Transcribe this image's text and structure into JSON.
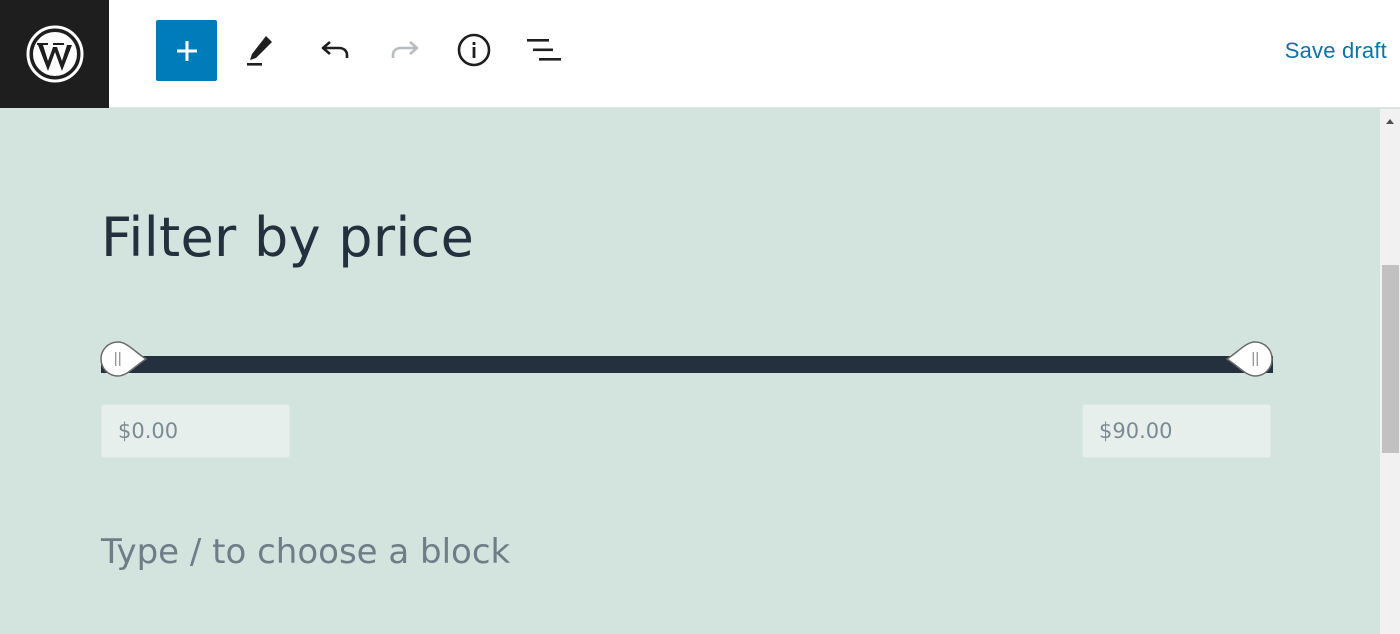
{
  "toolbar": {
    "logo_icon": "wordpress-logo-icon",
    "add_block_icon": "plus-icon",
    "tools_icon": "pencil-icon",
    "undo_icon": "undo-icon",
    "redo_icon": "redo-icon",
    "details_icon": "info-icon",
    "outline_icon": "list-outline-icon",
    "save_draft_label": "Save draft"
  },
  "block": {
    "title": "Filter by price",
    "slider": {
      "min_value": 0,
      "max_value": 90,
      "range_fill_fraction": 1.0
    },
    "min_price_value": "$0.00",
    "max_price_value": "$90.00"
  },
  "editor": {
    "placeholder": "Type / to choose a block"
  },
  "colors": {
    "accent": "#007cba",
    "canvas_background": "#d3e4df",
    "text_dark": "#24303d",
    "link": "#0a73a8"
  }
}
